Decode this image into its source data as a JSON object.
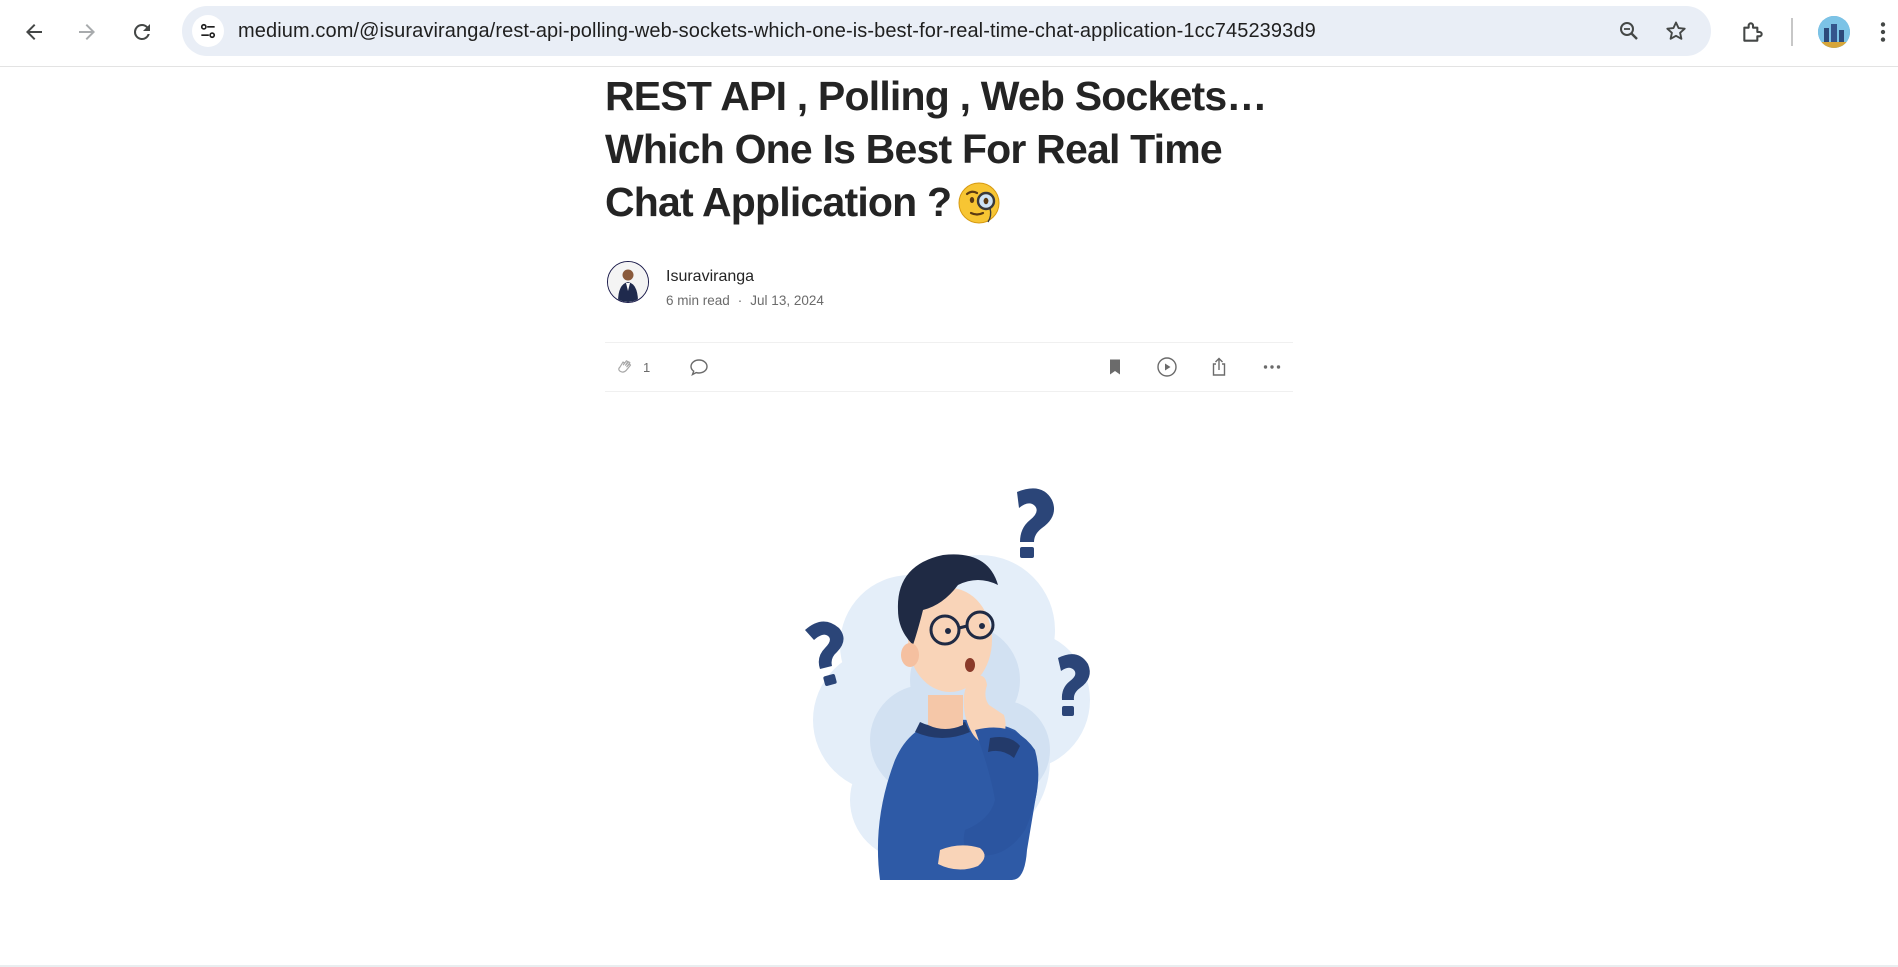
{
  "browser": {
    "url": "medium.com/@isuraviranga/rest-api-polling-web-sockets-which-one-is-best-for-real-time-chat-application-1cc7452393d9",
    "icons": {
      "back": "arrow-left-icon",
      "forward": "arrow-right-icon",
      "reload": "reload-icon",
      "site_info": "tune-icon",
      "zoom": "magnifier-icon",
      "bookmark": "star-icon",
      "extensions": "puzzle-icon",
      "profile": "avatar",
      "menu": "kebab-icon"
    }
  },
  "article": {
    "title": "REST API , Polling , Web Sockets… Which One Is Best For Real Time Chat Application ?",
    "title_emoji": "face-with-monocle",
    "author": {
      "name": "Isuraviranga",
      "read_time": "6 min read",
      "separator": "·",
      "date": "Jul 13, 2024"
    },
    "actions": {
      "clap_count": "1",
      "icons": [
        "clap-icon",
        "comment-icon",
        "bookmark-icon",
        "listen-icon",
        "share-icon",
        "more-icon"
      ]
    },
    "hero_image": "confused-man-with-question-marks"
  },
  "colors": {
    "text": "#242424",
    "muted": "#6b6b6b",
    "omnibox": "#e9eef6",
    "illustration_navy": "#233a6a",
    "illustration_blue": "#2e5aa6"
  }
}
